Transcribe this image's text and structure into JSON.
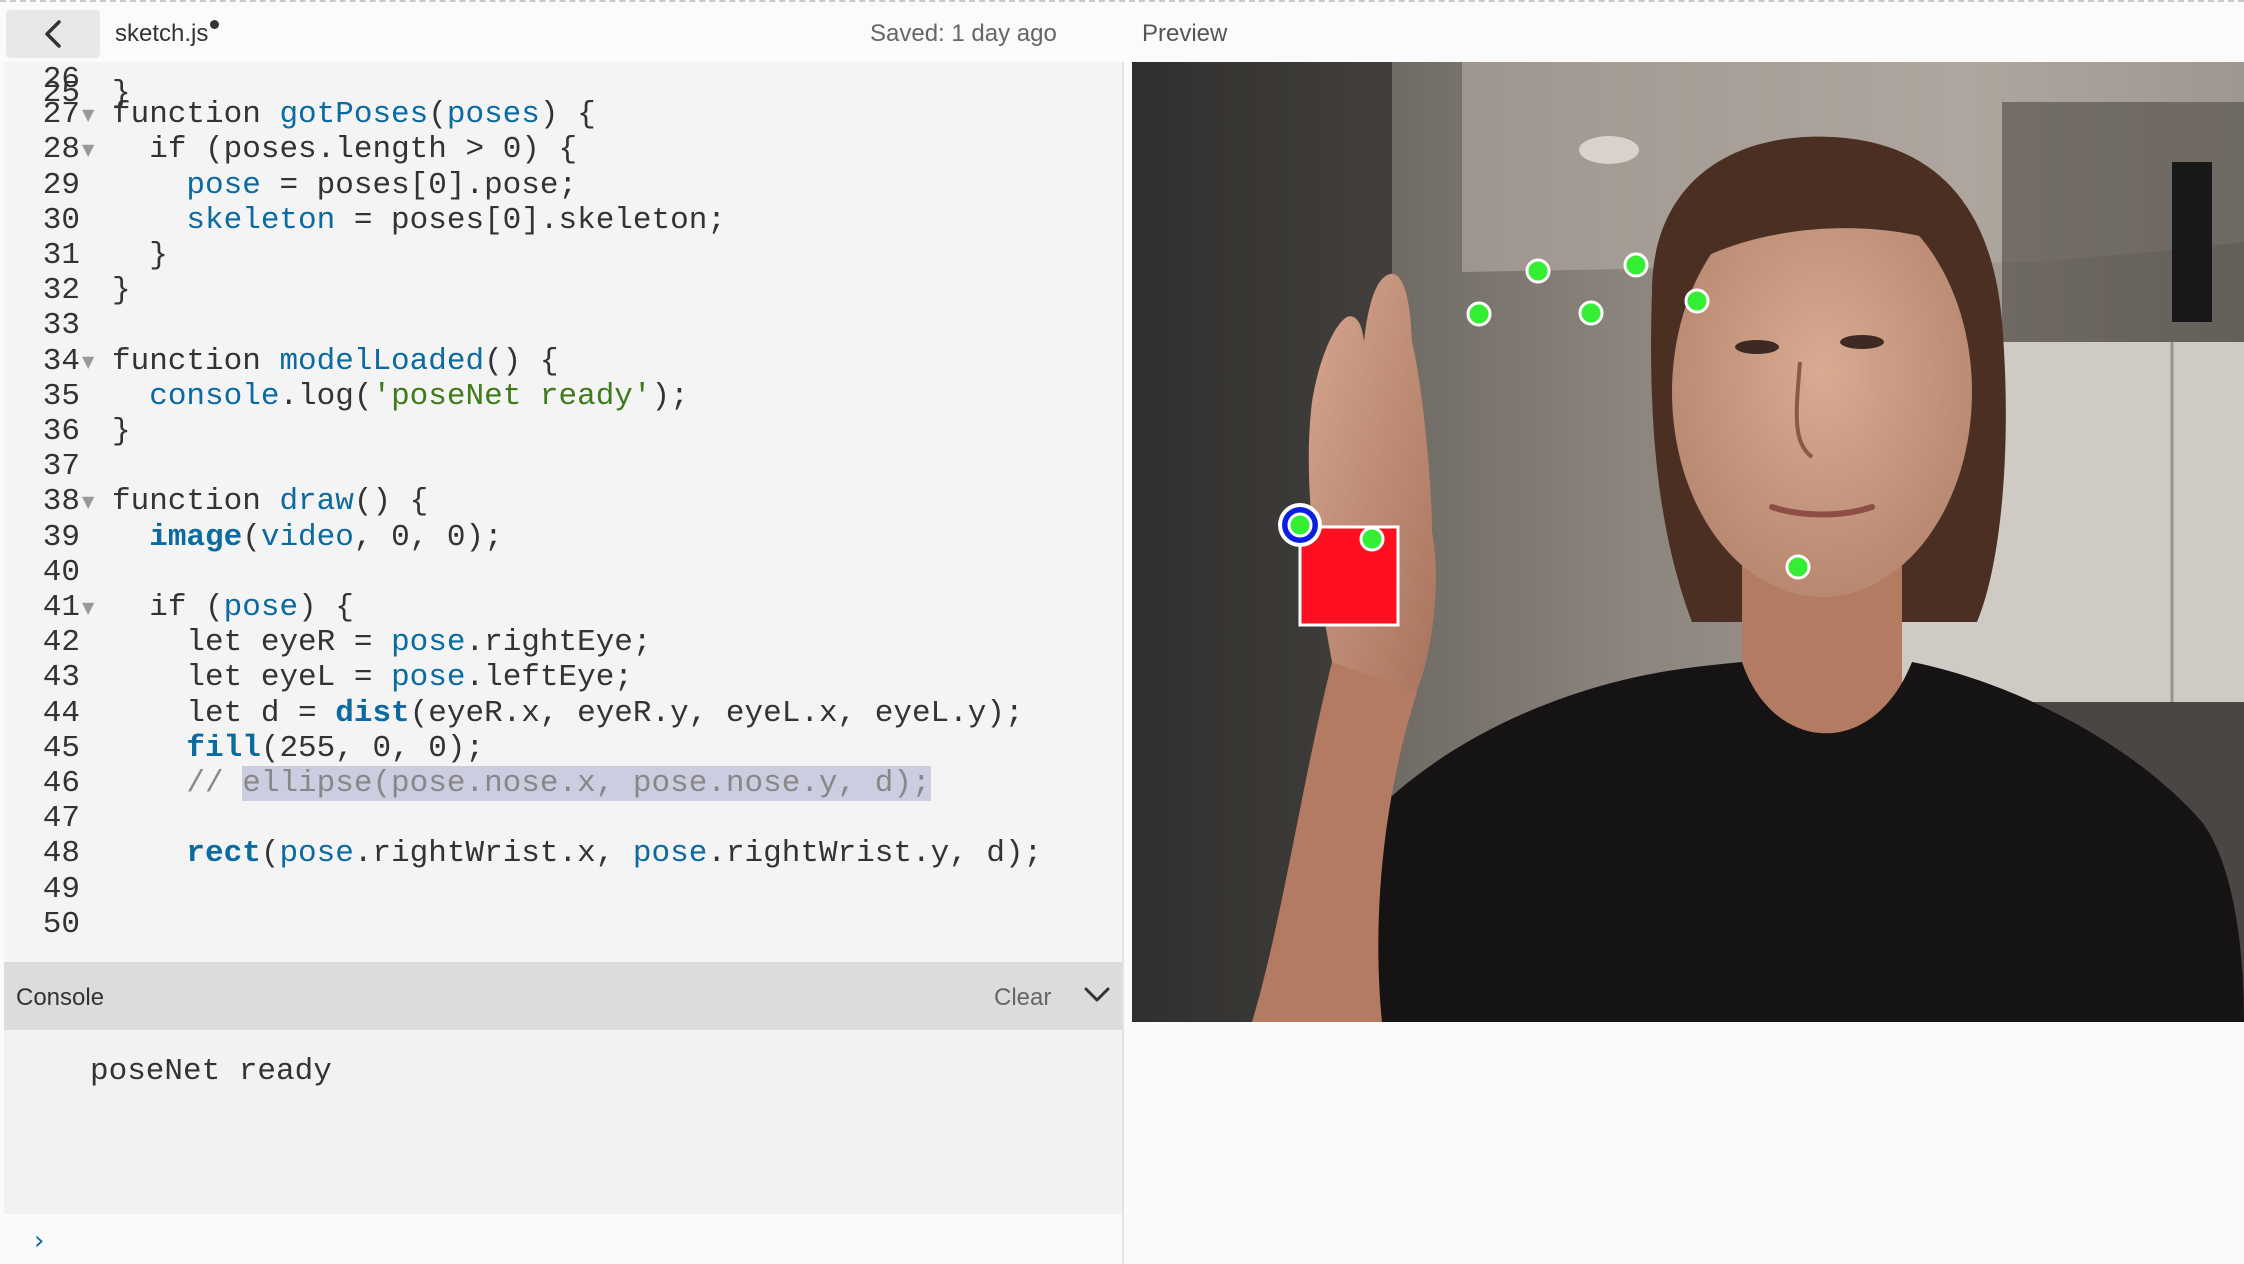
{
  "header": {
    "file_name": "sketch.js",
    "saved_status": "Saved: 1 day ago",
    "preview_label": "Preview"
  },
  "editor": {
    "lines": [
      {
        "n": "26",
        "fold": false,
        "html": ""
      },
      {
        "n": "27",
        "fold": true,
        "html": "<span class=\"kw\">function</span> <span class=\"fn\">gotPoses</span>(<span class=\"var\">poses</span>) {"
      },
      {
        "n": "28",
        "fold": true,
        "html": "  <span class=\"kw\">if</span> (poses.length &gt; 0) {"
      },
      {
        "n": "29",
        "fold": false,
        "html": "    <span class=\"var\">pose</span> = poses[0].pose;"
      },
      {
        "n": "30",
        "fold": false,
        "html": "    <span class=\"var\">skeleton</span> = poses[0].skeleton;"
      },
      {
        "n": "31",
        "fold": false,
        "html": "  }"
      },
      {
        "n": "32",
        "fold": false,
        "html": "}"
      },
      {
        "n": "33",
        "fold": false,
        "html": ""
      },
      {
        "n": "34",
        "fold": true,
        "html": "<span class=\"kw\">function</span> <span class=\"fn\">modelLoaded</span>() {"
      },
      {
        "n": "35",
        "fold": false,
        "html": "  <span class=\"var\">console</span>.log(<span class=\"str\">'poseNet ready'</span>);"
      },
      {
        "n": "36",
        "fold": false,
        "html": "}"
      },
      {
        "n": "37",
        "fold": false,
        "html": ""
      },
      {
        "n": "38",
        "fold": true,
        "html": "<span class=\"kw\">function</span> <span class=\"fn\">draw</span>() {"
      },
      {
        "n": "39",
        "fold": false,
        "html": "  <span class=\"fn bold\">image</span>(<span class=\"var\">video</span>, 0, 0);"
      },
      {
        "n": "40",
        "fold": false,
        "html": ""
      },
      {
        "n": "41",
        "fold": true,
        "html": "  <span class=\"kw\">if</span> (<span class=\"var\">pose</span>) {"
      },
      {
        "n": "42",
        "fold": false,
        "html": "    <span class=\"kw\">let</span> eyeR = <span class=\"var\">pose</span>.rightEye;"
      },
      {
        "n": "43",
        "fold": false,
        "html": "    <span class=\"kw\">let</span> eyeL = <span class=\"var\">pose</span>.leftEye;"
      },
      {
        "n": "44",
        "fold": false,
        "html": "    <span class=\"kw\">let</span> d = <span class=\"fn bold\">dist</span>(eyeR.x, eyeR.y, eyeL.x, eyeL.y);"
      },
      {
        "n": "45",
        "fold": false,
        "html": "    <span class=\"fn bold\">fill</span>(255, 0, 0);"
      },
      {
        "n": "46",
        "fold": false,
        "html": "    <span class=\"cmt\">// <span class=\"sel\">ellipse(pose.nose.x, pose.nose.y, d);</span></span>"
      },
      {
        "n": "47",
        "fold": false,
        "html": ""
      },
      {
        "n": "48",
        "fold": false,
        "html": "    <span class=\"fn bold\">rect</span>(<span class=\"var\">pose</span>.rightWrist.x, <span class=\"var\">pose</span>.rightWrist.y, d);"
      },
      {
        "n": "49",
        "fold": false,
        "html": ""
      },
      {
        "n": "50",
        "fold": false,
        "html": ""
      }
    ]
  },
  "console": {
    "title": "Console",
    "clear_label": "Clear",
    "message": "poseNet ready"
  },
  "colors": {
    "keypoint": "#33ee33",
    "rect_fill": "#ff1020",
    "wrist_ring": "#0a1fe0"
  }
}
